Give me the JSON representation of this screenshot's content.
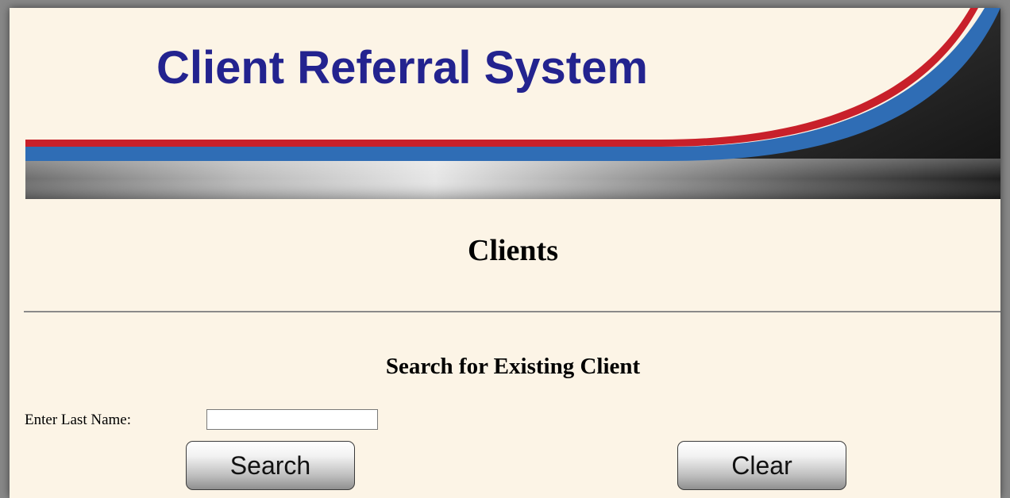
{
  "header": {
    "app_title": "Client Referral System"
  },
  "page": {
    "heading": "Clients"
  },
  "search": {
    "heading": "Search for Existing Client",
    "last_name_label": "Enter Last Name:",
    "last_name_value": "",
    "search_button": "Search",
    "clear_button": "Clear"
  },
  "colors": {
    "background": "#fcf4e6",
    "title_blue": "#23238f",
    "stripe_red": "#c8202a",
    "stripe_blue": "#2f6db5"
  }
}
